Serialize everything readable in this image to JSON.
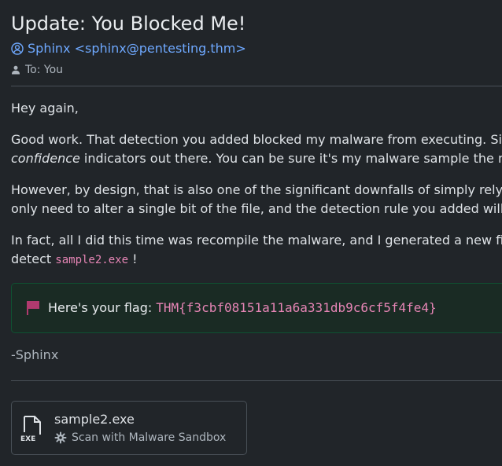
{
  "email": {
    "subject": "Update: You Blocked Me!",
    "sender": "Sphinx <sphinx@pentesting.thm>",
    "recipient": "To: You",
    "greeting": "Hey again,",
    "p1_text": "Good work. That detection you added blocked my malware from executing. Since file",
    "p1_em": "confidence",
    "p1_rest": " indicators out there. You can be sure it's my malware sample the next tin",
    "p2_line1": "However, by design, that is also one of the significant downfalls of simply relying on",
    "p2_line2": "only need to alter a single bit of the file, and the detection rule you added will fail.",
    "p3_line1": "In fact, all I did this time was recompile the malware, and I generated a new file hash",
    "p3_prefix": "detect ",
    "p3_code": "sample2.exe",
    "p3_suffix": " !",
    "flag_label": "Here's your flag:",
    "flag_value": "THM{f3cbf08151a11a6a331db9c6cf5f4fe4}",
    "signature": "-Sphinx"
  },
  "attachment": {
    "filename": "sample2.exe",
    "file_type_label": "EXE",
    "action_label": "Scan with Malware Sandbox"
  },
  "icons": {
    "sender": "user-circle-icon",
    "recipient": "user-icon",
    "flag": "flag-icon",
    "file": "exe-file-icon",
    "scan": "gear-icon"
  },
  "colors": {
    "background": "#212529",
    "link": "#6ea8fe",
    "code": "#e685b5",
    "flag_icon": "#b03a6e",
    "flag_box_bg": "#1a2b24",
    "flag_box_border": "#0f5132"
  }
}
